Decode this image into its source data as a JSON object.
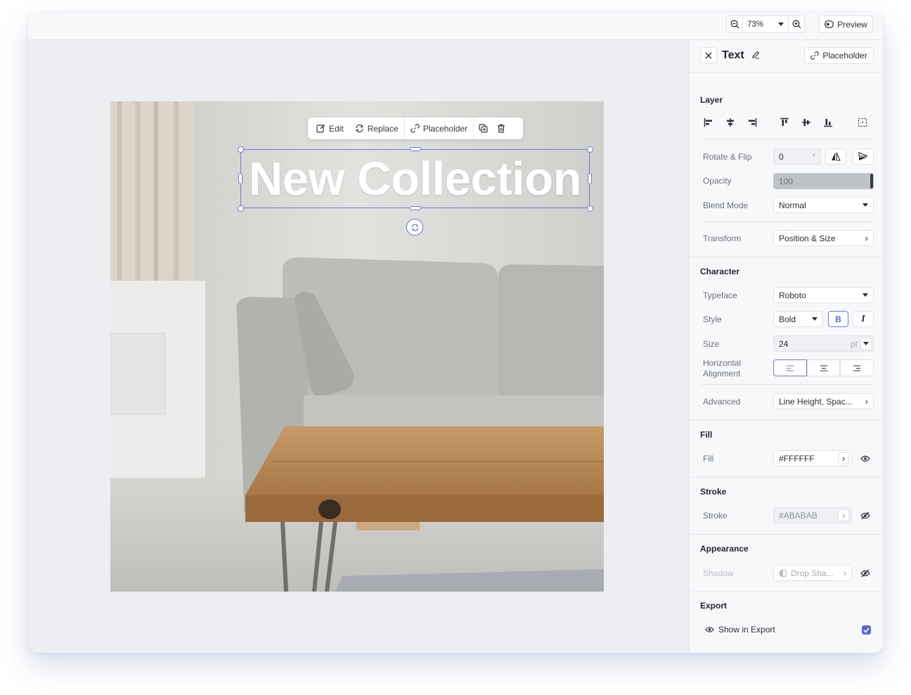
{
  "topbar": {
    "zoom": "73%",
    "preview_label": "Preview"
  },
  "canvas": {
    "headline": "New Collection",
    "toolbar": {
      "edit": "Edit",
      "replace": "Replace",
      "placeholder": "Placeholder"
    }
  },
  "panel": {
    "title": "Text",
    "placeholder_label": "Placeholder",
    "layer": {
      "title": "Layer",
      "rotate_label": "Rotate & Flip",
      "rotate_value": "0",
      "rotate_unit": "°",
      "opacity_label": "Opacity",
      "opacity_value": "100",
      "blend_label": "Blend Mode",
      "blend_value": "Normal",
      "transform_label": "Transform",
      "transform_value": "Position & Size"
    },
    "character": {
      "title": "Character",
      "typeface_label": "Typeface",
      "typeface_value": "Roboto",
      "style_label": "Style",
      "style_value": "Bold",
      "bold": "B",
      "italic": "I",
      "size_label": "Size",
      "size_value": "24",
      "size_unit": "pt",
      "halign_label_1": "Horizontal",
      "halign_label_2": "Alignment",
      "advanced_label": "Advanced",
      "advanced_value": "Line Height, Spac..."
    },
    "fill": {
      "title": "Fill",
      "label": "Fill",
      "value": "#FFFFFF"
    },
    "stroke": {
      "title": "Stroke",
      "label": "Stroke",
      "value": "#ABABAB"
    },
    "appearance": {
      "title": "Appearance",
      "shadow_label": "Shadow",
      "shadow_value": "Drop Sha..."
    },
    "export": {
      "title": "Export",
      "show_label": "Show in Export",
      "checked": true
    }
  },
  "colors": {
    "accent": "#6f78e0",
    "checkbox": "#5a65d9"
  }
}
